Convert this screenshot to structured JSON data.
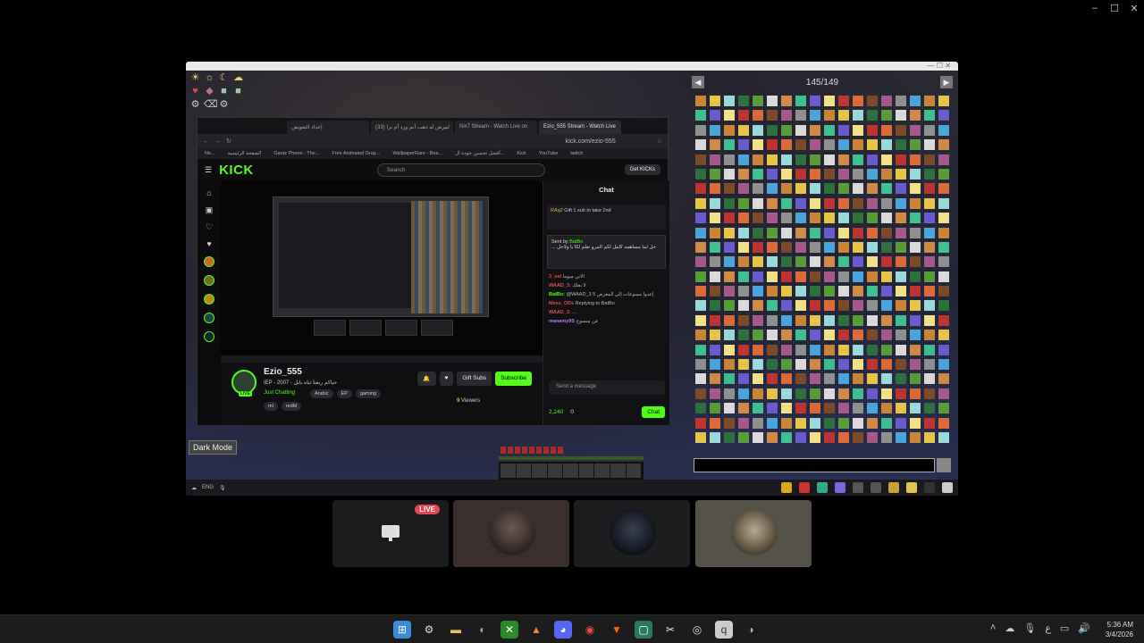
{
  "window": {
    "minimize": "–",
    "maximize": "☐",
    "close": "✕"
  },
  "browser": {
    "tabs": [
      "إعداد التعويض",
      "(33) لمرض له ذهب أنم ورد أم نرا",
      "Nix7 Stream - Watch Live on",
      "Ezio_555 Stream - Watch Live"
    ],
    "address": "kick.com/ezio-555",
    "bookmarks": [
      "Ne...",
      "الصفحة الرئيسية",
      "Gantz Phone - The...",
      "Free Animated Grap...",
      "WallpaperRare - Bea...",
      "أفضل تحسين جودة ال...",
      "Kick",
      "YouTube",
      "twitch"
    ]
  },
  "kick": {
    "logo": "KICK",
    "search_placeholder": "Search",
    "get_kicks": "Get KICKs",
    "streamer": "Ezio_555",
    "stream_title": "IEP - 2007 - حياكم ربعنا ثناه بابل",
    "category": "Just Chatting",
    "tags": [
      "Arabic",
      "EP",
      "gaming"
    ],
    "tags2": [
      "ml",
      "redM"
    ],
    "live_badge": "LIVE",
    "gift_subs": "Gift Subs",
    "subscribe": "Subscribe",
    "viewers_count": "9",
    "viewers_label": "Viewers"
  },
  "chat": {
    "title": "Chat",
    "pin_user": "RAq2",
    "pin_text": "Gift 1 sub to take 2nd",
    "alert_from": "Sent by",
    "alert_user": "BatBo",
    "alert_text": "... حل لما مساهمه كامل لكم المرو تعلم لكا يا ولاحل",
    "lines": [
      {
        "user": "3_usi",
        "text": "الاني ميوما"
      },
      {
        "user": "WAAD_3:",
        "text": "لا نعلك"
      },
      {
        "user": "BatBo:",
        "text": "@WAAD_3 5 إعدوا ممنوعات إلى المعرض"
      },
      {
        "user": "Mess_ODs",
        "text": "Replying to BatBo"
      },
      {
        "user": "WAAD_3:",
        "text": "..."
      },
      {
        "user": "manamy9S",
        "text": "عن منسوح"
      }
    ],
    "input_placeholder": "Send a message",
    "points": "2,240",
    "count": "0",
    "send": "Chat"
  },
  "game": {
    "dark_mode": "Dark Mode",
    "inventory_page": "145/149",
    "lang": "ENG"
  },
  "participants": {
    "live_label": "LIVE"
  },
  "clock": {
    "time": "5:36 AM",
    "date": "3/4/2026"
  },
  "taskbar": {
    "lang": "ع"
  }
}
